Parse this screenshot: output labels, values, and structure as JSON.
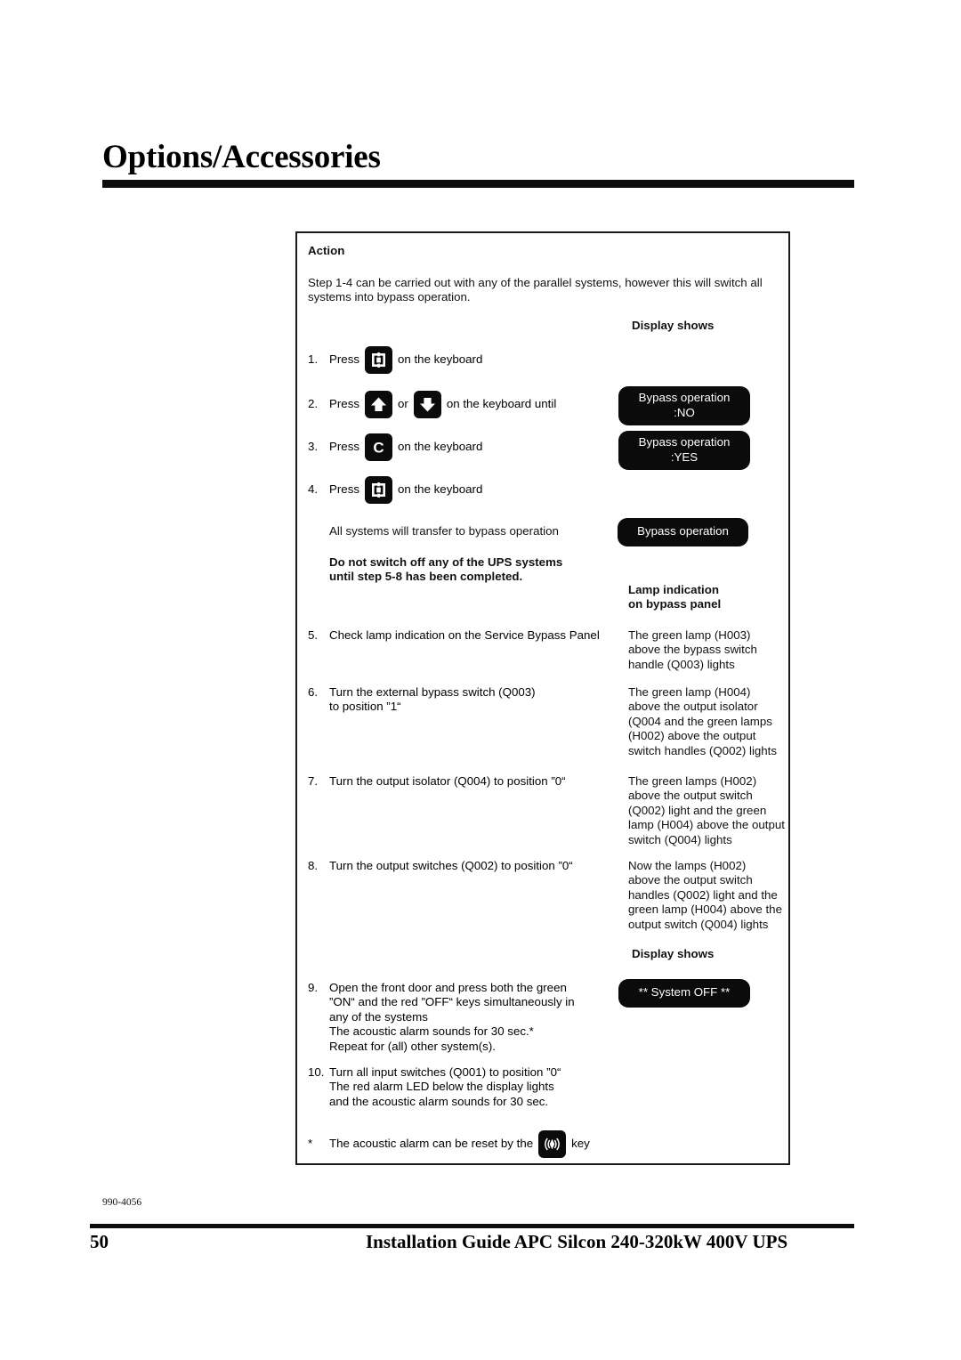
{
  "header": {
    "title": "Options/Accessories"
  },
  "panel": {
    "action_heading": "Action",
    "intro": "Step 1-4 can be carried out with any of the parallel systems, however this will switch all systems into bypass operation.",
    "display_shows_label_top": "Display shows",
    "display_shows_label_bottom": "Display shows",
    "lamp_indication_label": "Lamp indication\non bypass panel",
    "warning": "Do not switch off any of the UPS systems\nuntil step 5-8 has been completed.",
    "transfer_note": "All systems will transfer to bypass operation",
    "steps": [
      {
        "num": "1.",
        "press_label": "Press",
        "key": "display-key",
        "after_key": "on the keyboard"
      },
      {
        "num": "2.",
        "press_label": "Press",
        "key": "arrow-up-key",
        "separator": "or",
        "key2": "arrow-down-key",
        "after_key": "on the keyboard until"
      },
      {
        "num": "3.",
        "press_label": "Press",
        "key": "c-key",
        "after_key": "on the keyboard"
      },
      {
        "num": "4.",
        "press_label": "Press",
        "key": "display-key",
        "after_key": "on the keyboard"
      },
      {
        "num": "5.",
        "text": "Check lamp indication on the Service Bypass Panel",
        "result": "The green lamp (H003)\nabove the bypass switch\nhandle (Q003) lights"
      },
      {
        "num": "6.",
        "text": "Turn the external bypass switch (Q003)\nto position ”1“",
        "result": "The green lamp (H004)\nabove the output isolator\n(Q004 and the green lamps\n(H002) above the output\nswitch handles (Q002) lights"
      },
      {
        "num": "7.",
        "text": "Turn the output isolator (Q004) to position ”0“",
        "result": "The green lamps (H002)\nabove the output switch\n(Q002) light and the green\nlamp (H004) above the output\nswitch (Q004) lights"
      },
      {
        "num": "8.",
        "text": "Turn the output switches (Q002) to position ”0“",
        "result": "Now the lamps (H002)\nabove the output switch\nhandles (Q002) light and the\ngreen lamp (H004) above the\noutput switch (Q004) lights"
      },
      {
        "num": "9.",
        "text": "Open the front door and press both the green\n ”ON“ and the red ”OFF“ keys simultaneously in\nany of the systems\nThe acoustic alarm sounds for 30 sec.*\nRepeat for (all) other system(s)."
      },
      {
        "num": "10.",
        "text": "Turn all input switches (Q001) to position ”0“\nThe red alarm LED below the display lights\nand the acoustic alarm sounds for 30 sec."
      }
    ],
    "footnote": {
      "marker": "*",
      "before_key": "The acoustic alarm can be reset by the",
      "key": "alarm-key",
      "after_key": "key"
    },
    "displays": [
      {
        "text": "Bypass operation\n:NO"
      },
      {
        "text": "Bypass operation\n:YES"
      },
      {
        "text": "Bypass operation"
      },
      {
        "text": "** System OFF **"
      }
    ]
  },
  "footer": {
    "doc_number": "990-4056",
    "page_number": "50",
    "book_title": "Installation Guide APC Silcon 240-320kW 400V UPS"
  },
  "colors": {
    "ink": "#000000",
    "key_background": "#0b0b0b",
    "lcd_background": "#0b0b0b",
    "lcd_text": "#ffffff",
    "paper": "#ffffff"
  }
}
